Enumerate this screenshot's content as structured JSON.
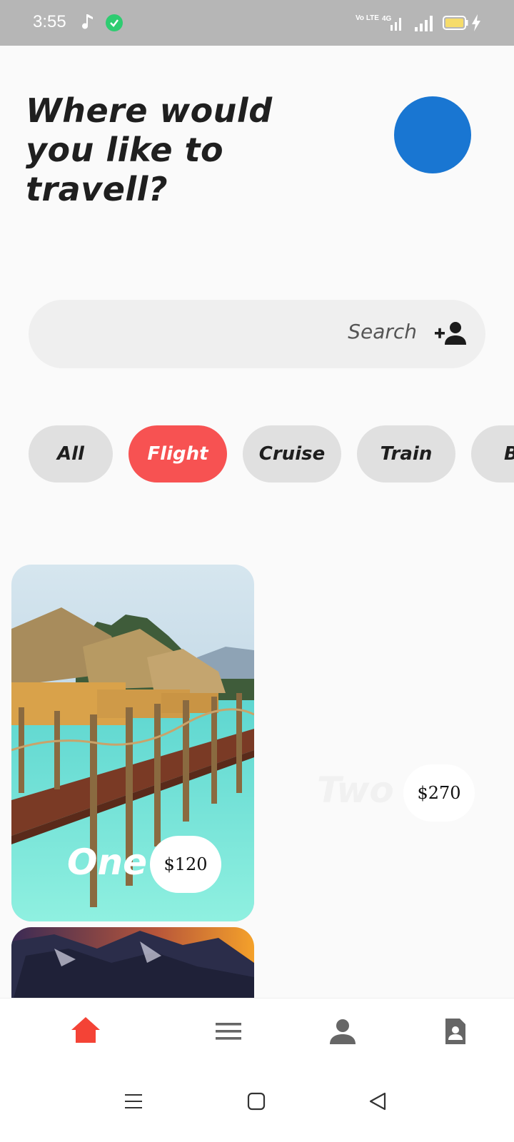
{
  "status_bar": {
    "time": "3:55",
    "volte_label": "Vo LTE",
    "network_label": "4G",
    "icons": [
      "music-note-icon",
      "check-circle-icon",
      "volte-icon",
      "4g-signal-icon",
      "signal-bars-icon",
      "battery-icon",
      "charging-bolt-icon"
    ]
  },
  "header": {
    "title": "Where would you like to travell?",
    "avatar_color": "#1976d2"
  },
  "search": {
    "label": "Search",
    "icon": "add-person-icon"
  },
  "categories": [
    {
      "label": "All",
      "selected": false
    },
    {
      "label": "Flight",
      "selected": true
    },
    {
      "label": "Cruise",
      "selected": false
    },
    {
      "label": "Train",
      "selected": false
    },
    {
      "label": "B",
      "selected": false
    }
  ],
  "cards": [
    {
      "title": "One",
      "price": "$120"
    },
    {
      "title": "Two",
      "price": "$270"
    }
  ],
  "bottom_nav": {
    "items": [
      "home-icon",
      "menu-icon",
      "person-icon",
      "contact-card-icon"
    ],
    "active_color": "#f44336"
  },
  "system_nav": [
    "recent-apps-icon",
    "home-square-icon",
    "back-icon"
  ],
  "colors": {
    "accent": "#f75252",
    "chip_bg": "#e0e0e0",
    "search_bg": "#efefef"
  }
}
